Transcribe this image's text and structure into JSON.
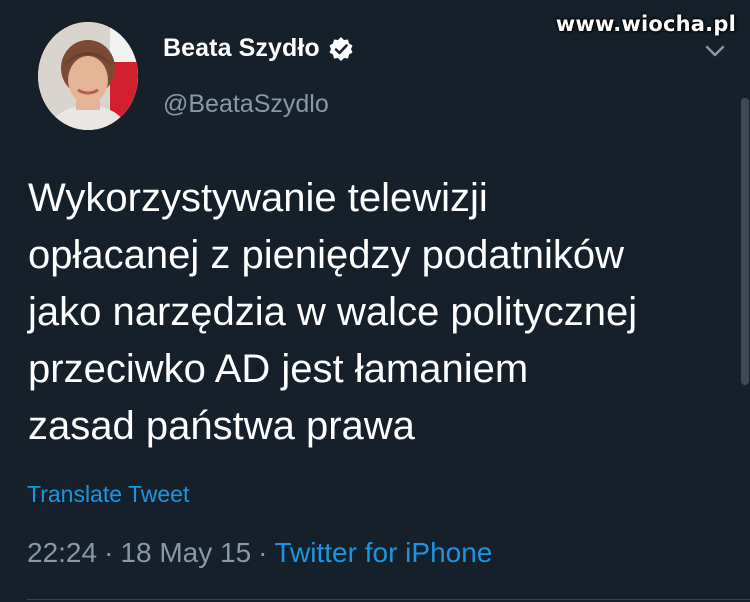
{
  "watermark": "www.wiocha.pl",
  "author": {
    "name": "Beata Szydło",
    "handle": "@BeataSzydlo",
    "verified": true
  },
  "tweet": {
    "lines": [
      "Wykorzystywanie telewizji",
      "opłacanej z pieniędzy podatników",
      "jako narzędzia w walce politycznej",
      "przeciwko AD jest łamaniem",
      "zasad państwa prawa"
    ],
    "translate_label": "Translate Tweet",
    "time": "22:24",
    "date": "18 May 15",
    "source": "Twitter for iPhone",
    "separator": "·"
  },
  "colors": {
    "background": "#15202b",
    "link": "#1b95e0",
    "secondary_text": "#8899a6",
    "primary_text": "#ffffff"
  },
  "icons": {
    "verified": "verified-badge-icon",
    "menu": "chevron-down-icon"
  }
}
